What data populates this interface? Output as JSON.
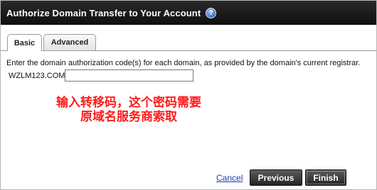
{
  "dialog": {
    "title": "Authorize Domain Transfer to Your Account",
    "help_icon": "question-mark-icon",
    "help_glyph": "?"
  },
  "tabs": [
    {
      "label": "Basic",
      "active": true
    },
    {
      "label": "Advanced",
      "active": false
    }
  ],
  "main": {
    "instruction": "Enter the domain authorization code(s) for each domain, as provided by the domain's current registrar.",
    "domain": "WZLM123.COM",
    "auth_code_value": ""
  },
  "annotation": {
    "line1": "输入转移码，这个密码需要",
    "line2": "原域名服务商索取",
    "color": "#ff1a1a"
  },
  "footer": {
    "cancel_label": "Cancel",
    "previous_label": "Previous",
    "finish_label": "Finish"
  }
}
